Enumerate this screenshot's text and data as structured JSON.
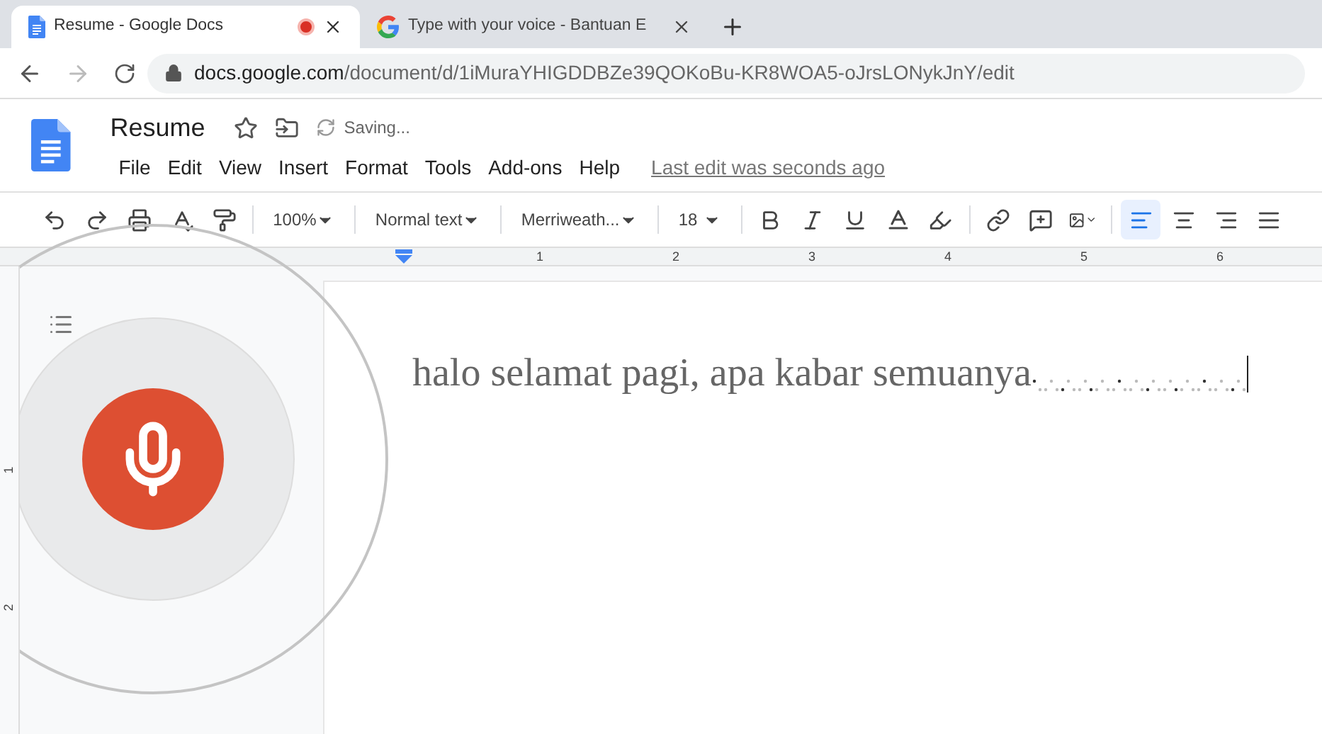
{
  "browser": {
    "tabs": [
      {
        "title": "Resume - Google Docs",
        "selected": true,
        "recording": true,
        "kind": "docs"
      },
      {
        "title": "Type with your voice - Bantuan E",
        "selected": false,
        "recording": false,
        "kind": "google"
      }
    ],
    "address": {
      "host": "docs.google.com",
      "path": "/document/d/1iMuraYHIGDDBZe39QOKoBu-KR8WOA5-oJrsLONykJnY/edit"
    }
  },
  "docs": {
    "title": "Resume",
    "status": "Saving...",
    "menu": [
      "File",
      "Edit",
      "View",
      "Insert",
      "Format",
      "Tools",
      "Add-ons",
      "Help"
    ],
    "last_edit": "Last edit was seconds ago"
  },
  "toolbar": {
    "zoom": "100%",
    "style": "Normal text",
    "font": "Merriweath...",
    "size": "18",
    "align": [
      {
        "kind": "left",
        "selected": true
      },
      {
        "kind": "center",
        "selected": false
      },
      {
        "kind": "right",
        "selected": false
      },
      {
        "kind": "justify",
        "selected": false
      }
    ]
  },
  "ruler": {
    "marks": [
      "1",
      "2",
      "3",
      "4",
      "5",
      "6"
    ],
    "vertical_marks": [
      "1",
      "2"
    ]
  },
  "voice_typing": {
    "listening": true
  },
  "document": {
    "text": "halo selamat pagi, apa kabar semuanya"
  }
}
